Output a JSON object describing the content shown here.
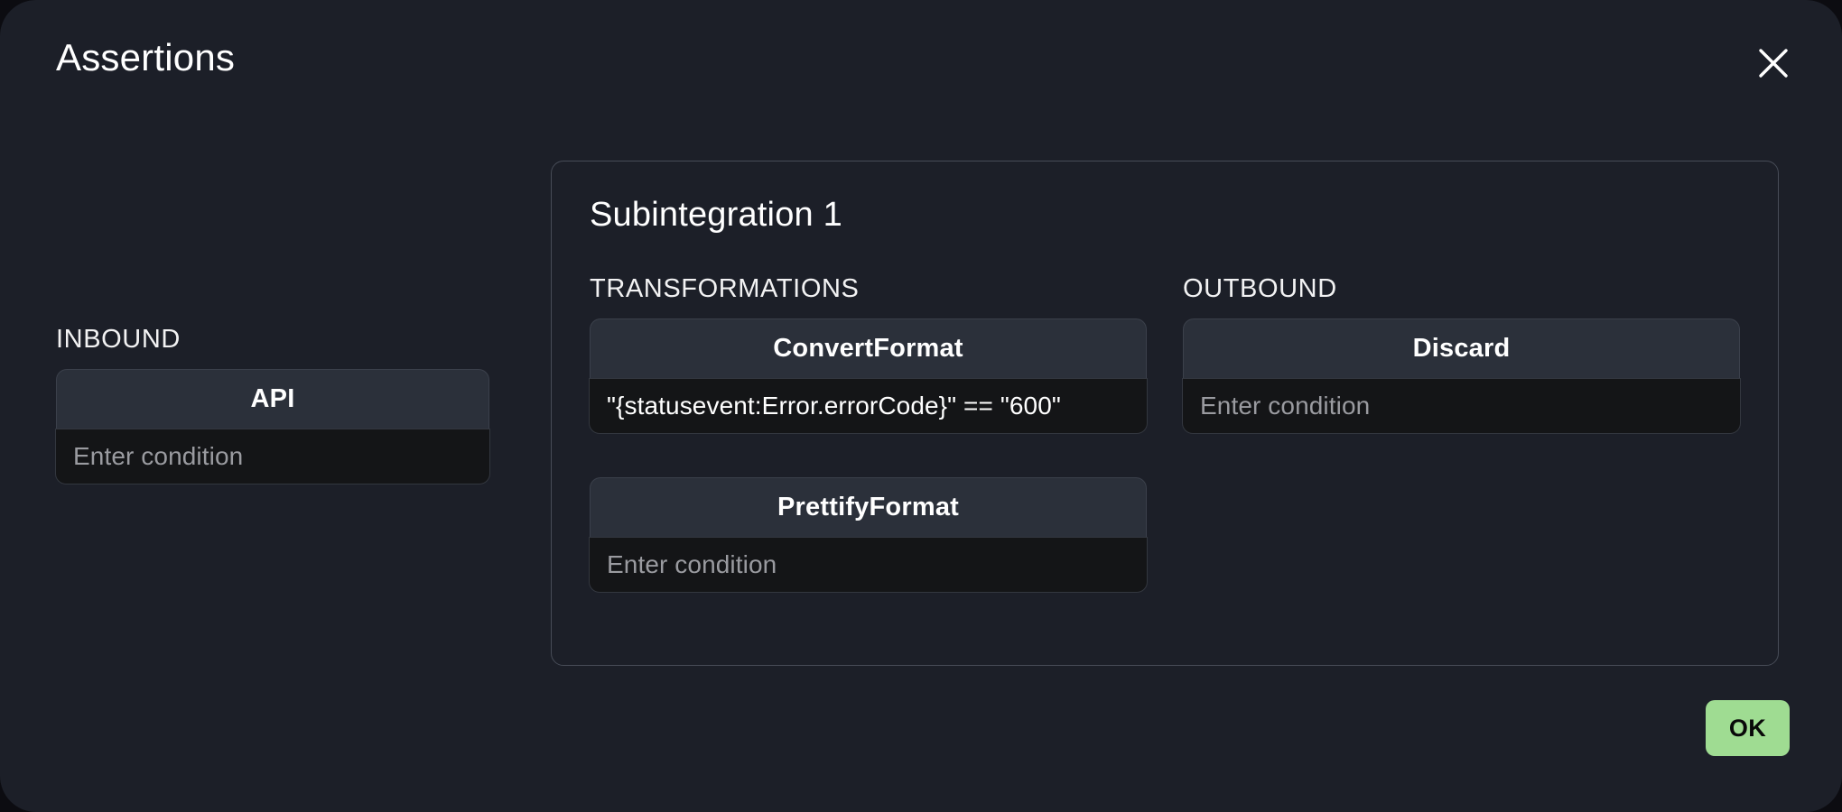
{
  "dialog": {
    "title": "Assertions",
    "close_icon": "close-x-icon",
    "ok_label": "OK",
    "accent_color": "#9fdc92",
    "background_color": "#1c1f28",
    "panel_border_color": "#474c57",
    "card_header_color": "#2b303a",
    "card_input_color": "#141517"
  },
  "inbound": {
    "label": "INBOUND",
    "cards": [
      {
        "title": "API",
        "value": "",
        "placeholder": "Enter condition"
      }
    ]
  },
  "subintegration": {
    "title": "Subintegration 1",
    "transformations": {
      "label": "TRANSFORMATIONS",
      "cards": [
        {
          "title": "ConvertFormat",
          "value": "\"{statusevent:Error.errorCode}\" == \"600\"",
          "placeholder": "Enter condition"
        },
        {
          "title": "PrettifyFormat",
          "value": "",
          "placeholder": "Enter condition"
        }
      ]
    },
    "outbound": {
      "label": "OUTBOUND",
      "cards": [
        {
          "title": "Discard",
          "value": "",
          "placeholder": "Enter condition"
        }
      ]
    }
  }
}
